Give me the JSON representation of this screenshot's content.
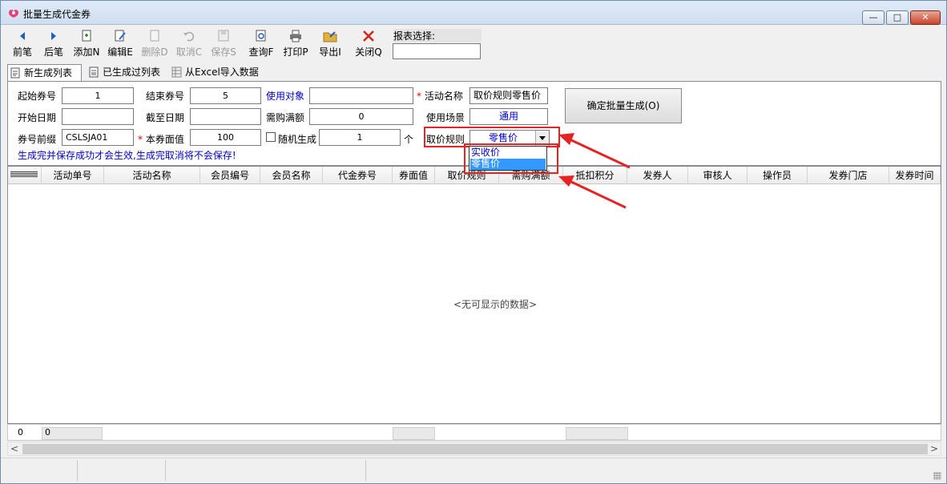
{
  "window": {
    "title": "批量生成代金券",
    "min_symbol": "—",
    "max_symbol": "□",
    "close_symbol": "✕"
  },
  "toolbar": {
    "buttons": [
      {
        "label": "前笔",
        "icon": "arrow-left-icon",
        "enabled": true
      },
      {
        "label": "后笔",
        "icon": "arrow-right-icon",
        "enabled": true
      },
      {
        "label": "添加N",
        "icon": "add-document-icon",
        "enabled": true
      },
      {
        "label": "编辑E",
        "icon": "edit-icon",
        "enabled": true
      },
      {
        "label": "删除D",
        "icon": "delete-icon",
        "enabled": false
      },
      {
        "label": "取消C",
        "icon": "undo-icon",
        "enabled": false
      },
      {
        "label": "保存S",
        "icon": "save-icon",
        "enabled": false
      },
      {
        "label": "查询F",
        "icon": "search-icon",
        "enabled": true
      },
      {
        "label": "打印P",
        "icon": "printer-icon",
        "enabled": true
      },
      {
        "label": "导出I",
        "icon": "export-folder-icon",
        "enabled": true
      },
      {
        "label": "关闭Q",
        "icon": "close-x-icon",
        "enabled": true
      }
    ],
    "report_select_label": "报表选择:",
    "report_select_value": ""
  },
  "tabs": [
    {
      "label": "新生成列表",
      "active": true
    },
    {
      "label": "已生成过列表",
      "active": false
    },
    {
      "label": "从Excel导入数据",
      "active": false
    }
  ],
  "form": {
    "start_no_label": "起始券号",
    "start_no_value": "1",
    "end_no_label": "结束券号",
    "end_no_value": "5",
    "use_target_label": "使用对象",
    "use_target_value": "",
    "activity_name_label": "活动名称",
    "activity_name_value": "取价规则零售价",
    "start_date_label": "开始日期",
    "start_date_value": "",
    "end_date_label": "截至日期",
    "end_date_value": "",
    "min_purchase_label": "需购满额",
    "min_purchase_value": "0",
    "scene_label": "使用场景",
    "scene_value": "通用",
    "prefix_label": "券号前缀",
    "prefix_value": "CSLSJA01",
    "face_value_label": "本券面值",
    "face_value_value": "100",
    "random_label": "随机生成",
    "random_value": "1",
    "random_unit": "个",
    "price_rule_label": "取价规则",
    "price_rule_value": "零售价",
    "confirm_button": "确定批量生成(O)",
    "hint": "生成完并保存成功才会生效,生成完取消将不会保存!",
    "required_mark": "*"
  },
  "dropdown": {
    "options": [
      "实收价",
      "零售价"
    ],
    "selected_index": 1
  },
  "grid": {
    "columns": [
      "活动单号",
      "活动名称",
      "会员编号",
      "会员名称",
      "代金券号",
      "券面值",
      "取价规则",
      "需购满额",
      "抵扣积分",
      "发券人",
      "审核人",
      "操作员",
      "发券门店",
      "发券时间"
    ],
    "empty_text": "<无可显示的数据>"
  },
  "footer": {
    "count": "0",
    "sum": "0"
  },
  "scroll": {
    "left_arrow": "<",
    "right_arrow": ">"
  },
  "colors": {
    "highlight_red": "#e52323",
    "link_blue": "#0000cc",
    "selection_blue": "#3399ff"
  }
}
